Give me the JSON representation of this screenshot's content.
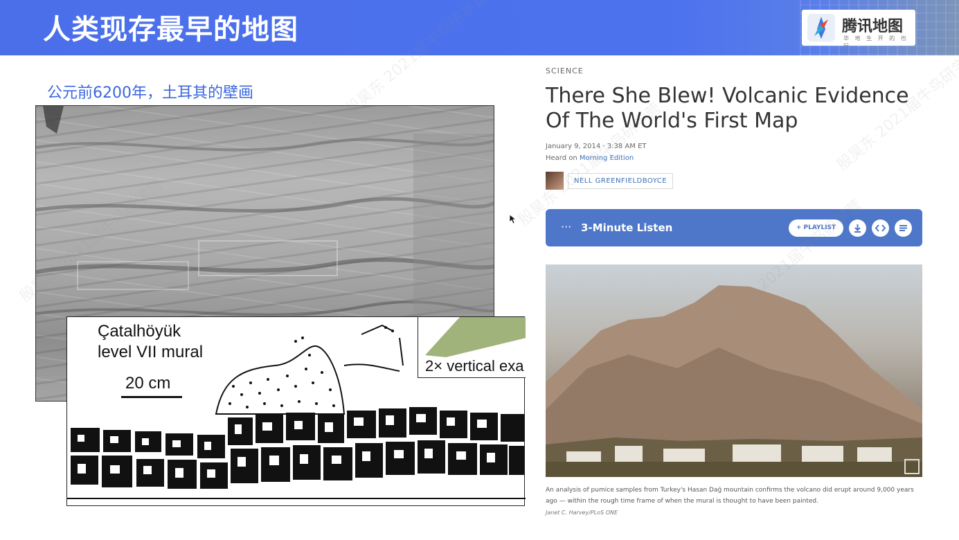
{
  "slide": {
    "title": "人类现存最早的地图",
    "subtitle": "公元前6200年，土耳其的壁画"
  },
  "logo": {
    "name": "腾讯地图",
    "tagline": "华 地 生 开 的 也 行"
  },
  "mural_diagram": {
    "label_line1": "Çatalhöyük",
    "label_line2": "level VII mural",
    "scale": "20 cm",
    "inset_label": "2× vertical exa"
  },
  "article": {
    "section": "SCIENCE",
    "headline": "There She Blew! Volcanic Evidence Of The World's First Map",
    "date": "January 9, 2014 · 3:38 AM ET",
    "heard_on_prefix": "Heard on",
    "heard_on_program": "Morning Edition",
    "author": "NELL GREENFIELDBOYCE",
    "player": {
      "menu": "···",
      "label": "3-Minute Listen",
      "playlist": "+ PLAYLIST"
    },
    "caption": "An analysis of pumice samples from Turkey's Hasan Dağ mountain confirms the volcano did erupt around 9,000 years ago — within the rough time frame of when the mural is thought to have been painted.",
    "credit": "Janet C. Harvey/PLoS ONE"
  },
  "watermark": "殷昊东 2021届牛鸟研学营",
  "colors": {
    "banner": "#4d72ee",
    "player": "#4e77c9",
    "subtitle": "#3b67e0",
    "link": "#3c6fb6"
  }
}
